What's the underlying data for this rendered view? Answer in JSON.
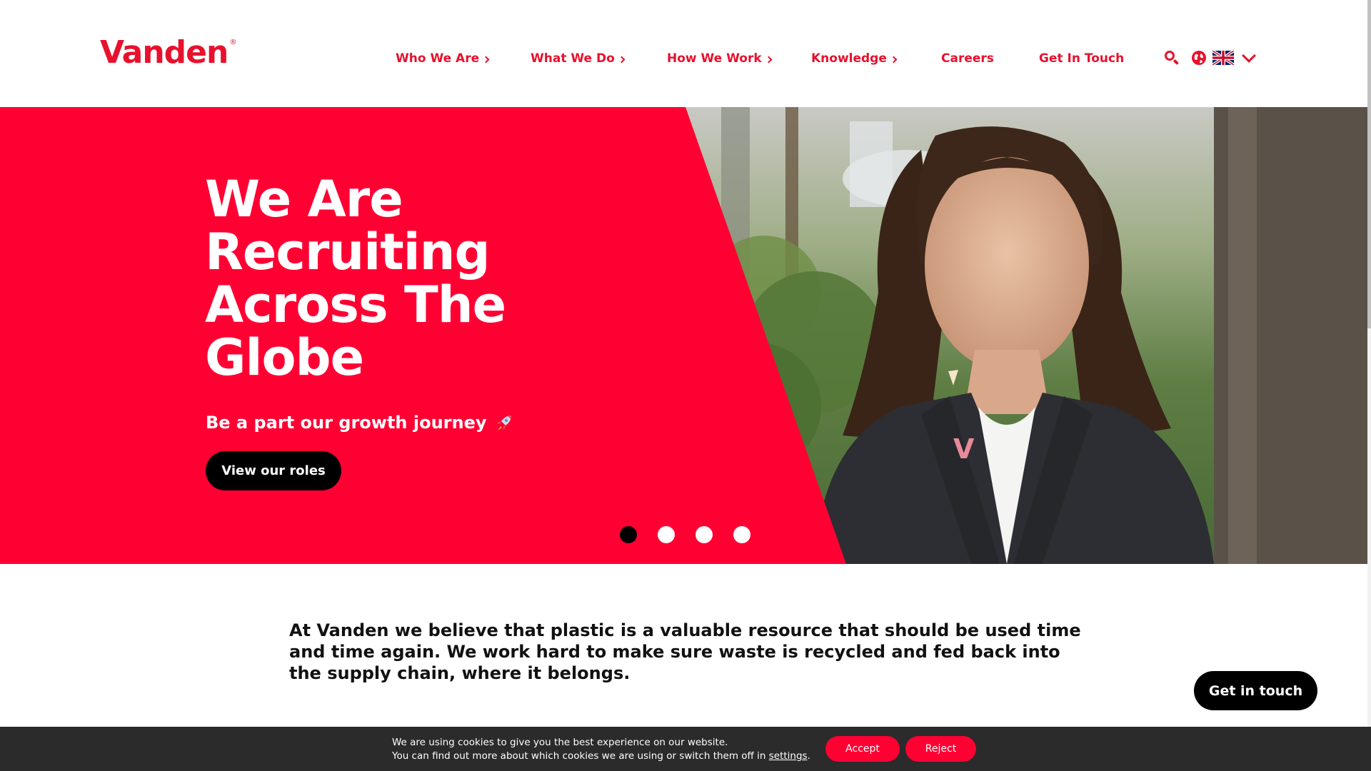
{
  "brand": {
    "logo_text": "Vanden",
    "registered_mark": "®",
    "color": "#e8112d",
    "hero_color": "#ff0033"
  },
  "nav": {
    "items": [
      {
        "label": "Who We Are",
        "has_chevron": true
      },
      {
        "label": "What We Do",
        "has_chevron": true
      },
      {
        "label": "How We Work",
        "has_chevron": true
      },
      {
        "label": "Knowledge",
        "has_chevron": true
      },
      {
        "label": "Careers",
        "has_chevron": false
      },
      {
        "label": "Get In Touch",
        "has_chevron": false
      }
    ],
    "icons": [
      "search-icon",
      "globe-icon",
      "uk-flag-icon",
      "chevron-down-icon"
    ]
  },
  "hero": {
    "title": "We Are Recruiting Across The Globe",
    "subtitle": "Be a part our growth journey",
    "subtitle_icon": "rocket-icon",
    "button_label": "View our roles",
    "slides": {
      "count": 4,
      "active_index": 0
    }
  },
  "intro": {
    "text": "At Vanden we believe that plastic is a valuable resource that should be used time and time again. We work hard to make sure waste is recycled and fed back into the supply chain, where it belongs."
  },
  "floating_button": {
    "label": "Get in touch"
  },
  "cookie_bar": {
    "line1": "We are using cookies to give you the best experience on our website.",
    "line2_prefix": "You can find out more about which cookies we are using or switch them off in",
    "link_label": "settings",
    "line2_suffix": ".",
    "accept_label": "Accept",
    "reject_label": "Reject"
  }
}
